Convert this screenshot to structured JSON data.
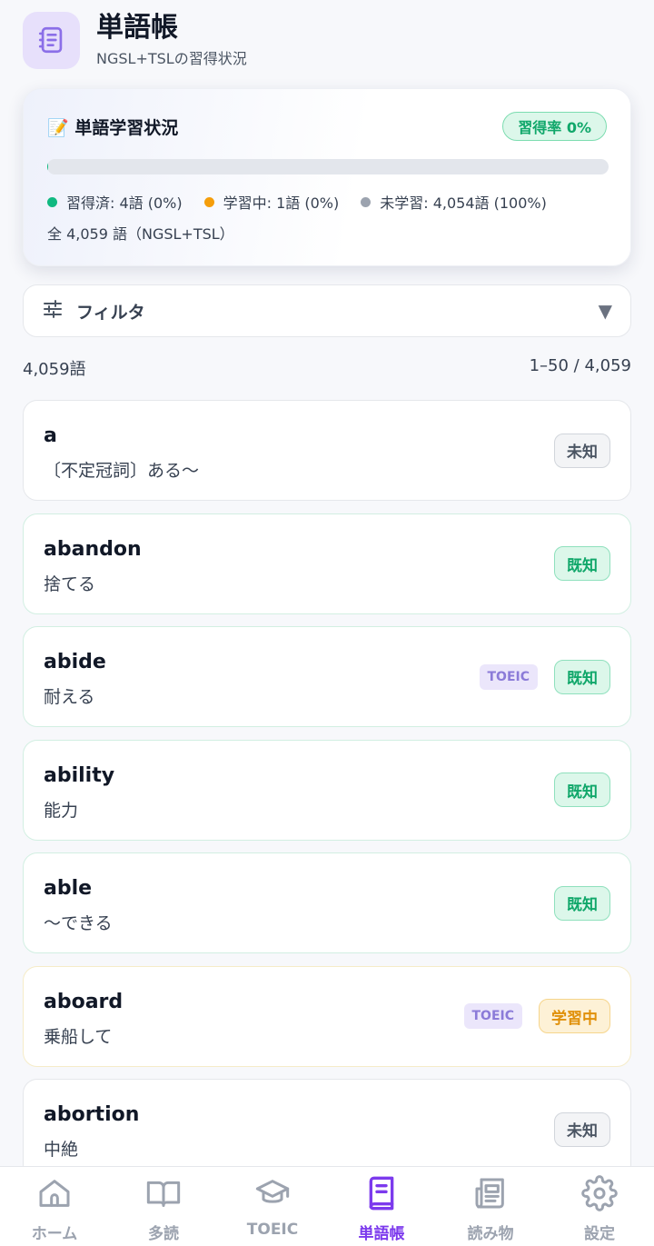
{
  "header": {
    "title": "単語帳",
    "subtitle": "NGSL+TSLの習得状況"
  },
  "status_card": {
    "title": "📝 単語学習状況",
    "rate_label": "習得率 0%",
    "progress_fraction": 0.001,
    "legend": [
      {
        "label": "習得済: 4語 (0%)",
        "color": "#10b981"
      },
      {
        "label": "学習中: 1語 (0%)",
        "color": "#f59e0b"
      },
      {
        "label": "未学習: 4,054語 (100%)",
        "color": "#9ca3af"
      }
    ],
    "total": "全 4,059 語（NGSL+TSL）"
  },
  "filter": {
    "label": "フィルタ",
    "caret": "▼"
  },
  "list_info": {
    "count": "4,059語",
    "range": "1–50 / 4,059"
  },
  "words": [
    {
      "word": "a",
      "meaning": "〔不定冠詞〕ある〜",
      "tag": "",
      "status": "未知",
      "status_type": "unknown"
    },
    {
      "word": "abandon",
      "meaning": "捨てる",
      "tag": "",
      "status": "既知",
      "status_type": "known"
    },
    {
      "word": "abide",
      "meaning": "耐える",
      "tag": "TOEIC",
      "status": "既知",
      "status_type": "known"
    },
    {
      "word": "ability",
      "meaning": "能力",
      "tag": "",
      "status": "既知",
      "status_type": "known"
    },
    {
      "word": "able",
      "meaning": "〜できる",
      "tag": "",
      "status": "既知",
      "status_type": "known"
    },
    {
      "word": "aboard",
      "meaning": "乗船して",
      "tag": "TOEIC",
      "status": "学習中",
      "status_type": "learning"
    },
    {
      "word": "abortion",
      "meaning": "中絶",
      "tag": "",
      "status": "未知",
      "status_type": "unknown"
    }
  ],
  "nav": [
    {
      "label": "ホーム",
      "icon": "home-icon",
      "active": false
    },
    {
      "label": "多読",
      "icon": "book-open-icon",
      "active": false
    },
    {
      "label": "TOEIC",
      "icon": "graduation-cap-icon",
      "active": false
    },
    {
      "label": "単語帳",
      "icon": "notebook-icon",
      "active": true
    },
    {
      "label": "読み物",
      "icon": "newspaper-icon",
      "active": false
    },
    {
      "label": "設定",
      "icon": "gear-icon",
      "active": false
    }
  ],
  "colors": {
    "accent": "#7c3aed",
    "known": "#10a76a",
    "learning": "#e0900a",
    "tag": "#8b7bd8"
  }
}
